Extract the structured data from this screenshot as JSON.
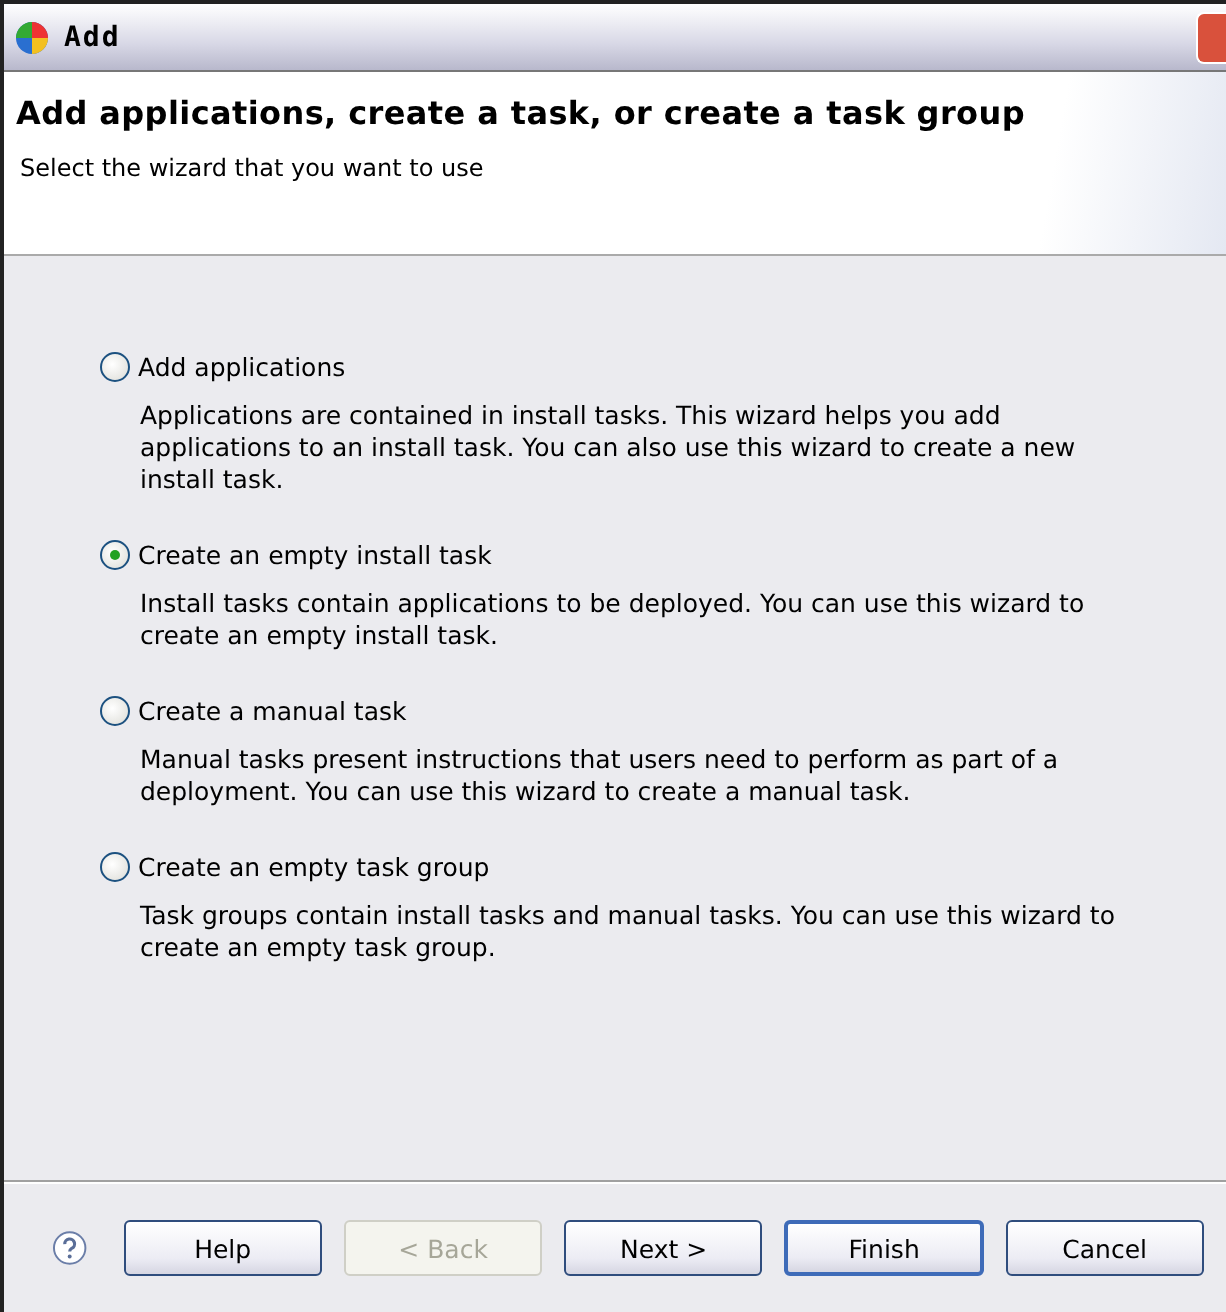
{
  "window": {
    "title": "Add"
  },
  "header": {
    "title": "Add applications, create a task, or create a task group",
    "subtitle": "Select the wizard that you want to use"
  },
  "options": [
    {
      "label": "Add applications",
      "selected": false,
      "description": "Applications are contained in install tasks. This wizard helps you add applications to an install task. You can also use this wizard to create a new install task."
    },
    {
      "label": "Create an empty install task",
      "selected": true,
      "description": "Install tasks contain applications to be deployed. You can use this wizard to create an empty install task."
    },
    {
      "label": "Create a manual task",
      "selected": false,
      "description": "Manual tasks present instructions that users need to perform as part of a deployment. You can use this wizard to create a manual task."
    },
    {
      "label": "Create an empty task group",
      "selected": false,
      "description": "Task groups contain install tasks and manual tasks. You can use this wizard to create an empty task group."
    }
  ],
  "buttons": [
    {
      "label": "Help",
      "disabled": false,
      "default": false
    },
    {
      "label": "< Back",
      "disabled": true,
      "default": false
    },
    {
      "label": "Next >",
      "disabled": false,
      "default": false
    },
    {
      "label": "Finish",
      "disabled": false,
      "default": true
    },
    {
      "label": "Cancel",
      "disabled": false,
      "default": false
    }
  ]
}
